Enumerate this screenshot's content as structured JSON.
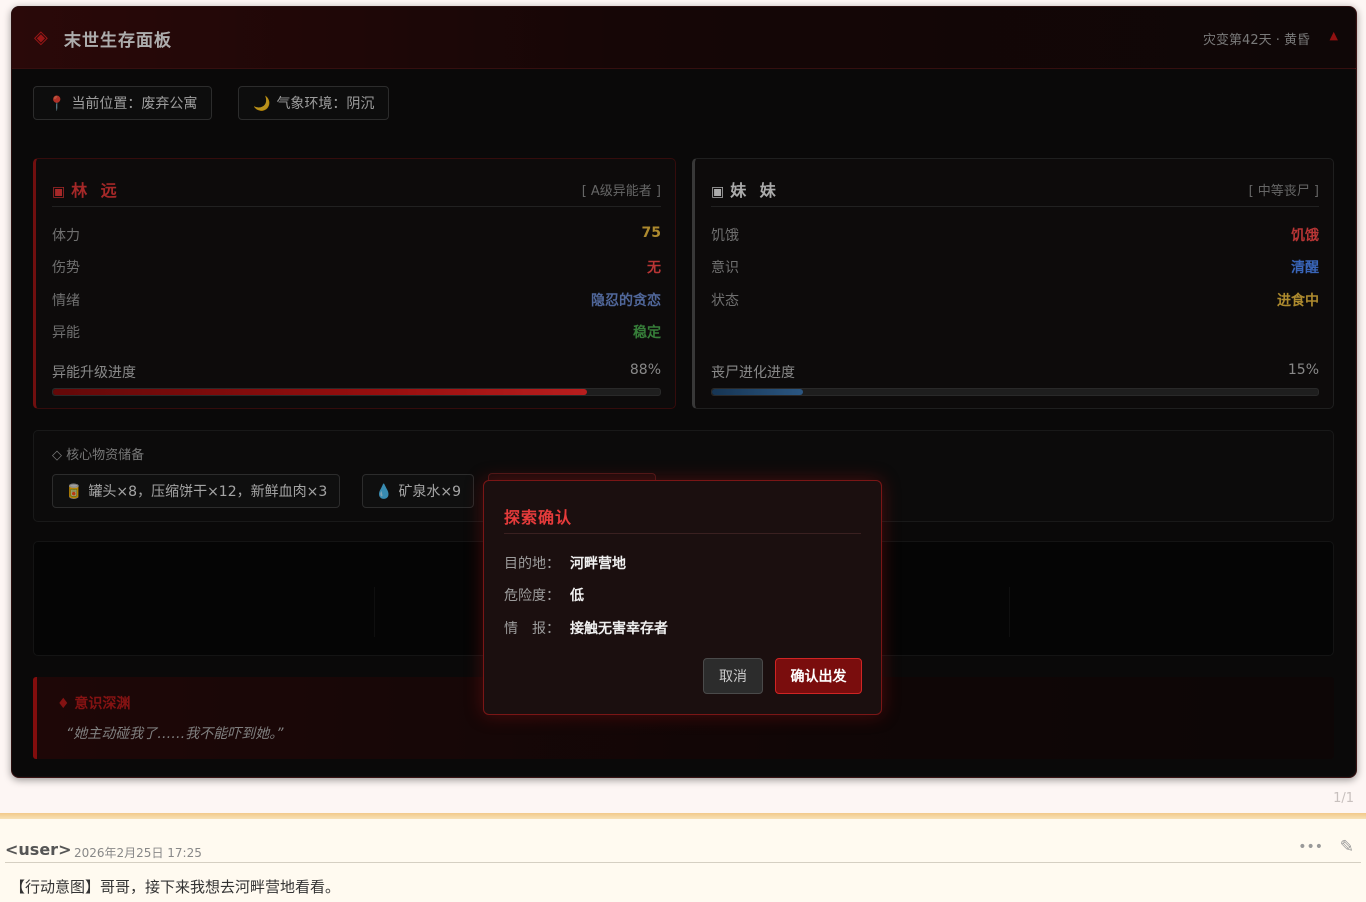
{
  "header": {
    "title": "末世生存面板",
    "day_info": "灾变第42天 · 黄昏",
    "diamond_glyph": "◈",
    "collapse_glyph": "▲"
  },
  "status_chips": [
    {
      "icon": "📍",
      "label": "当前位置：废弃公寓"
    },
    {
      "icon": "🌙",
      "label": "气象环境：阴沉"
    }
  ],
  "characters": [
    {
      "name": "林 远",
      "tag": "[ A级异能者 ]",
      "stats": [
        {
          "key": "体力",
          "value": "75",
          "color": "#f0c040"
        },
        {
          "key": "伤势",
          "value": "无",
          "color": "#ff4a4a"
        },
        {
          "key": "情绪",
          "value": "隐忍的贪恋",
          "color": "#6f8fd6"
        },
        {
          "key": "异能",
          "value": "稳定",
          "color": "#4caf50"
        }
      ],
      "progress": {
        "label": "异能升级进度",
        "value_text": "88%",
        "value": 88,
        "color": "#d01414"
      }
    },
    {
      "name": "妹 妹",
      "tag": "[ 中等丧尸 ]",
      "stats": [
        {
          "key": "饥饿",
          "value": "饥饿",
          "color": "#ff4a4a"
        },
        {
          "key": "意识",
          "value": "清醒",
          "color": "#4f8cff"
        },
        {
          "key": "状态",
          "value": "进食中",
          "color": "#f0c040"
        }
      ],
      "progress": {
        "label": "丧尸进化进度",
        "value_text": "15%",
        "value": 15,
        "color": "#3c78b4"
      }
    }
  ],
  "supplies": {
    "title": "◇ 核心物资储备",
    "items": [
      {
        "icon": "🥫",
        "label": "罐头×8，压缩饼干×12，新鲜血肉×3"
      },
      {
        "icon": "💧",
        "label": "矿泉水×9"
      }
    ]
  },
  "abyss": {
    "title": "♦ 意识深渊",
    "quote": "“她主动碰我了……我不能吓到她。”"
  },
  "modal": {
    "title": "探索确认",
    "rows": [
      {
        "key": "目的地：",
        "value": "河畔营地"
      },
      {
        "key": "危险度：",
        "value": "低"
      },
      {
        "key": "情　报：",
        "value": "接触无害幸存者"
      }
    ],
    "cancel_label": "取消",
    "confirm_label": "确认出发"
  },
  "page_counter": "1/1",
  "message": {
    "user": "<user>",
    "time": "2026年2月25日 17:25",
    "text": "【行动意图】哥哥，接下来我想去河畔营地看看。",
    "menu_glyph": "•••",
    "edit_glyph": "✎"
  }
}
